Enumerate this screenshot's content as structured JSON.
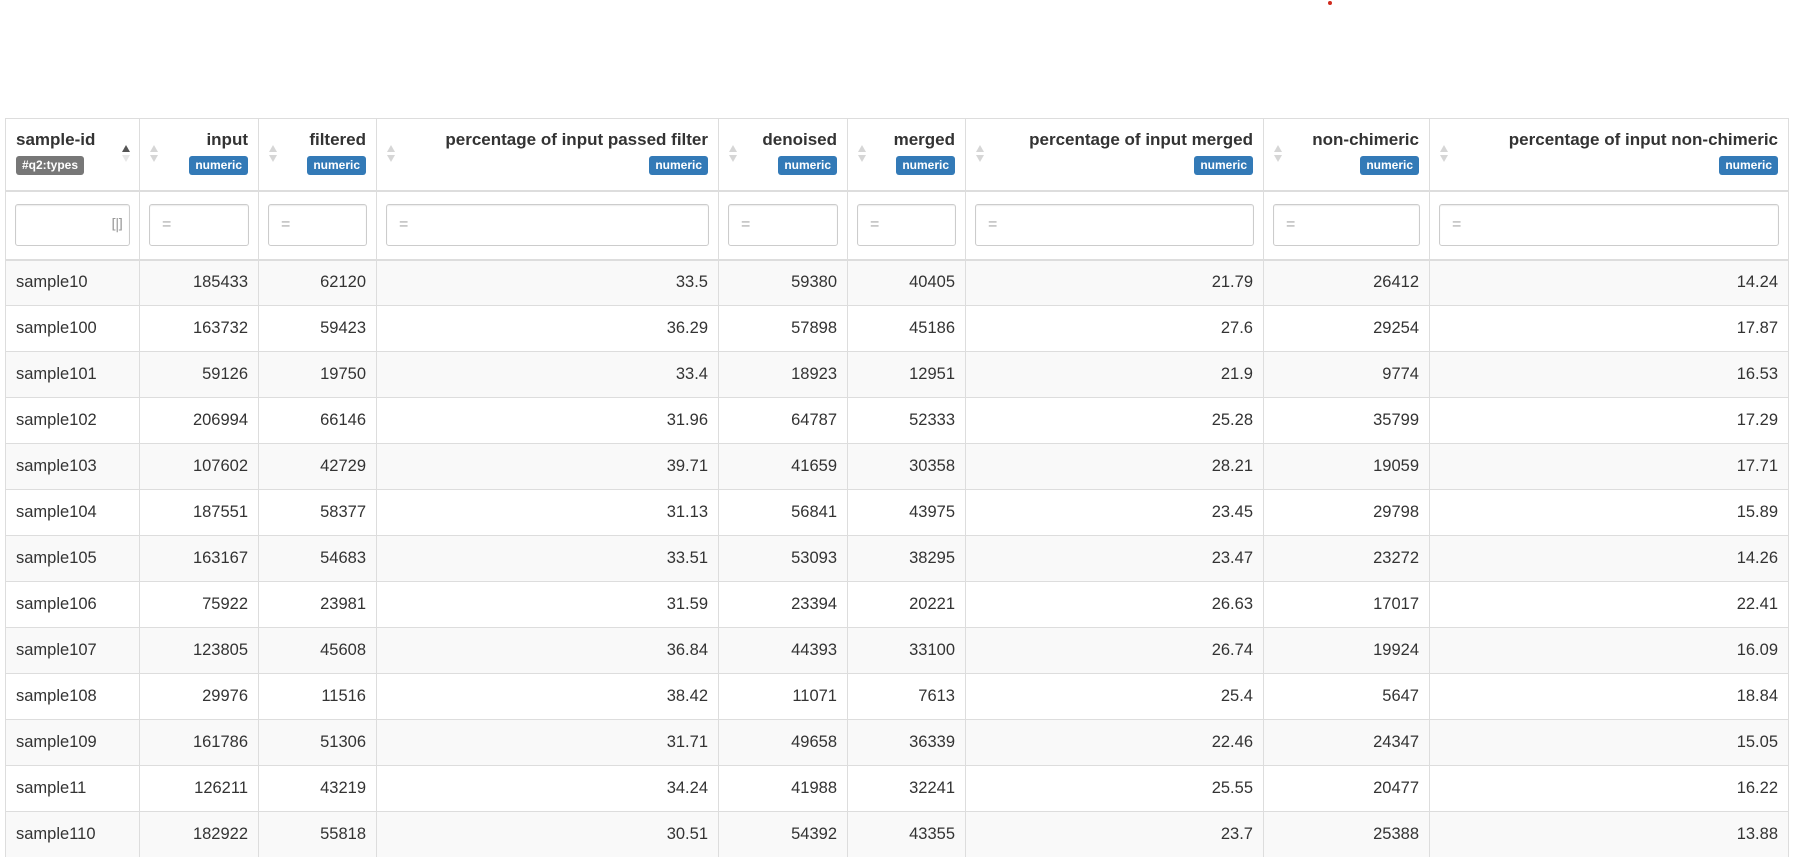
{
  "accent_colors": {
    "numeric_badge": "#337ab7",
    "types_badge": "#777777",
    "marker_dot": "#d02b1e"
  },
  "table": {
    "columns": [
      {
        "label": "sample-id",
        "badge": "#q2:types",
        "sort": "ascending"
      },
      {
        "label": "input",
        "badge": "numeric"
      },
      {
        "label": "filtered",
        "badge": "numeric"
      },
      {
        "label": "percentage of input passed filter",
        "badge": "numeric"
      },
      {
        "label": "denoised",
        "badge": "numeric"
      },
      {
        "label": "merged",
        "badge": "numeric"
      },
      {
        "label": "percentage of input merged",
        "badge": "numeric"
      },
      {
        "label": "non-chimeric",
        "badge": "numeric"
      },
      {
        "label": "percentage of input non-chimeric",
        "badge": "numeric"
      }
    ],
    "filters": {
      "placeholder": "=",
      "range_icon": "column-range-icon"
    },
    "rows": [
      [
        "sample10",
        "185433",
        "62120",
        "33.5",
        "59380",
        "40405",
        "21.79",
        "26412",
        "14.24"
      ],
      [
        "sample100",
        "163732",
        "59423",
        "36.29",
        "57898",
        "45186",
        "27.6",
        "29254",
        "17.87"
      ],
      [
        "sample101",
        "59126",
        "19750",
        "33.4",
        "18923",
        "12951",
        "21.9",
        "9774",
        "16.53"
      ],
      [
        "sample102",
        "206994",
        "66146",
        "31.96",
        "64787",
        "52333",
        "25.28",
        "35799",
        "17.29"
      ],
      [
        "sample103",
        "107602",
        "42729",
        "39.71",
        "41659",
        "30358",
        "28.21",
        "19059",
        "17.71"
      ],
      [
        "sample104",
        "187551",
        "58377",
        "31.13",
        "56841",
        "43975",
        "23.45",
        "29798",
        "15.89"
      ],
      [
        "sample105",
        "163167",
        "54683",
        "33.51",
        "53093",
        "38295",
        "23.47",
        "23272",
        "14.26"
      ],
      [
        "sample106",
        "75922",
        "23981",
        "31.59",
        "23394",
        "20221",
        "26.63",
        "17017",
        "22.41"
      ],
      [
        "sample107",
        "123805",
        "45608",
        "36.84",
        "44393",
        "33100",
        "26.74",
        "19924",
        "16.09"
      ],
      [
        "sample108",
        "29976",
        "11516",
        "38.42",
        "11071",
        "7613",
        "25.4",
        "5647",
        "18.84"
      ],
      [
        "sample109",
        "161786",
        "51306",
        "31.71",
        "49658",
        "36339",
        "22.46",
        "24347",
        "15.05"
      ],
      [
        "sample11",
        "126211",
        "43219",
        "34.24",
        "41988",
        "32241",
        "25.55",
        "20477",
        "16.22"
      ],
      [
        "sample110",
        "182922",
        "55818",
        "30.51",
        "54392",
        "43355",
        "23.7",
        "25388",
        "13.88"
      ]
    ]
  }
}
